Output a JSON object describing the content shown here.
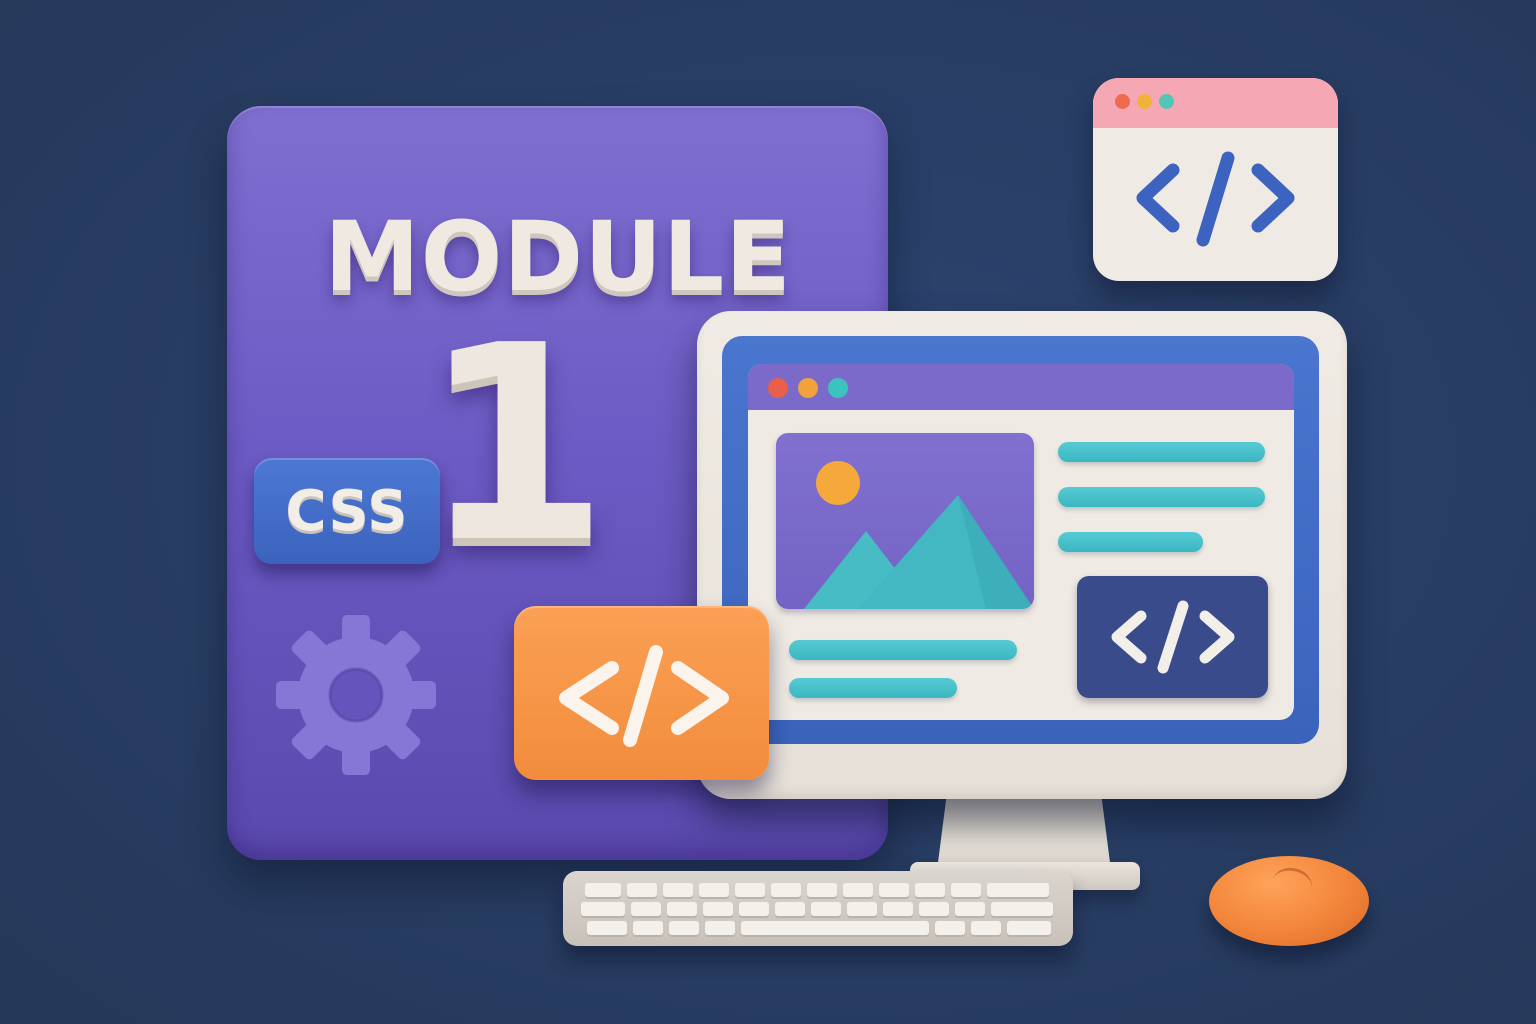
{
  "module_card": {
    "title": "MODULE",
    "number": "1",
    "badge_label": "CSS",
    "color": "#6c5bc4"
  },
  "icons": {
    "gear": "gear-icon",
    "code": "code-brackets-icon",
    "image": "image-mountain-icon"
  },
  "colors": {
    "background": "#283d63",
    "purple": "#7b6ac9",
    "orange": "#f28c3c",
    "teal": "#3bb6c2",
    "blue": "#3a63bc",
    "cream": "#efeae3",
    "pink": "#f6a7b4"
  },
  "browser_dots": [
    "#e95f4a",
    "#f2a23a",
    "#3cc3bf"
  ],
  "mini_window_dots": [
    "#f06a4f",
    "#f2b23a",
    "#4fc6b8"
  ]
}
